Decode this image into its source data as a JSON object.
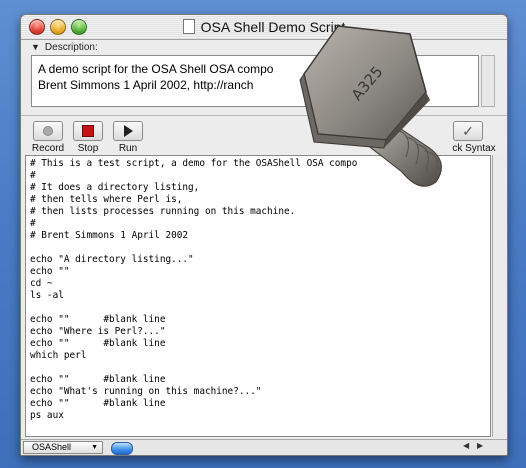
{
  "window": {
    "title": "OSA Shell Demo Script"
  },
  "description": {
    "label": "Description:",
    "text": "A demo script for the OSA Shell OSA compo\nBrent Simmons 1 April 2002, http://ranch                   osashell/"
  },
  "toolbar": {
    "record_label": "Record",
    "stop_label": "Stop",
    "run_label": "Run",
    "check_syntax_label": "ck Syntax"
  },
  "script": {
    "text": "# This is a test script, a demo for the OSAShell OSA compo\n#\n# It does a directory listing,\n# then tells where Perl is,\n# then lists processes running on this machine.\n#\n# Brent Simmons 1 April 2002\n\necho \"A directory listing...\"\necho \"\"\ncd ~\nls -al\n\necho \"\"      #blank line\necho \"Where is Perl?...\"\necho \"\"      #blank line\nwhich perl\n\necho \"\"      #blank line\necho \"What's running on this machine?...\"\necho \"\"      #blank line\nps aux"
  },
  "bottom": {
    "language": "OSAShell"
  },
  "overlay": {
    "bolt_head_text": "A325"
  }
}
